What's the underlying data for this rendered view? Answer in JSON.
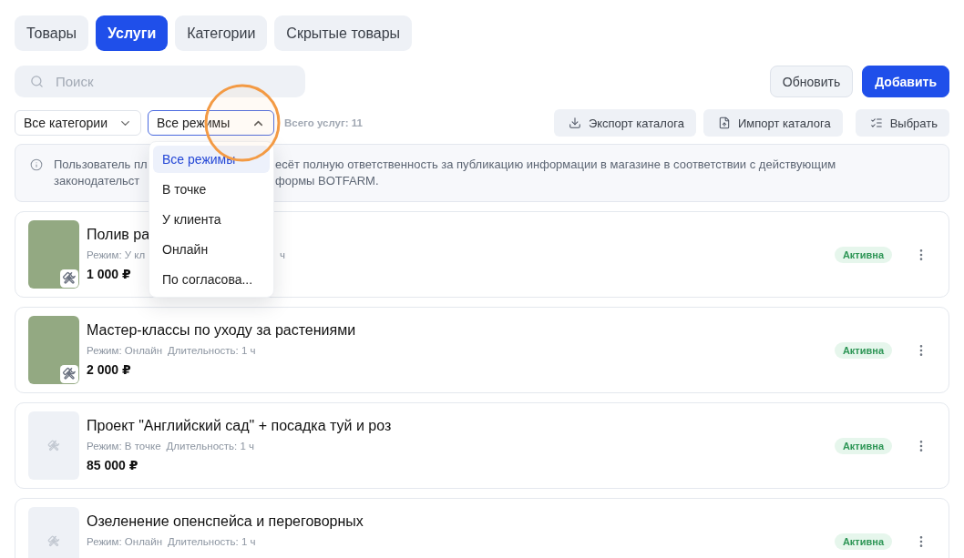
{
  "tabs": [
    {
      "label": "Товары",
      "selected": false
    },
    {
      "label": "Услуги",
      "selected": true
    },
    {
      "label": "Категории",
      "selected": false
    },
    {
      "label": "Скрытые товары",
      "selected": false
    }
  ],
  "search": {
    "placeholder": "Поиск"
  },
  "header_buttons": [
    {
      "label": "Обновить",
      "kind": "secondary"
    },
    {
      "label": "Добавить",
      "kind": "primary"
    }
  ],
  "filters": [
    {
      "value": "Все категории",
      "expanded": false
    },
    {
      "value": "Все режимы",
      "expanded": true,
      "options": [
        {
          "label": "Все режимы",
          "selected": true
        },
        {
          "label": "В точке",
          "selected": false
        },
        {
          "label": "У клиента",
          "selected": false
        },
        {
          "label": "Онлайн",
          "selected": false
        },
        {
          "label": "По согласова...",
          "selected": false
        }
      ]
    }
  ],
  "total": "Всего услуг: 11",
  "actions": [
    {
      "label": "Экспорт каталога"
    },
    {
      "label": "Импорт каталога"
    },
    {
      "label": "Выбрать"
    }
  ],
  "notice": {
    "lines": [
      [
        "Пользователь пл",
        "есёт полную ответственность за публикацию информации в магазине в соответствии с действующим"
      ],
      [
        "законодательст",
        "формы BOTFARM."
      ]
    ]
  },
  "services": [
    {
      "kind": "photo",
      "title": "Полив ра",
      "mode": "Режим: У кл",
      "duration": "ч",
      "price": "1 000 ₽",
      "status": "Активна",
      "partly_covered": true
    },
    {
      "kind": "photo",
      "title": "Мастер-классы по уходу за растениями",
      "mode": "Режим: Онлайн",
      "duration": "Длительность: 1 ч",
      "price": "2 000 ₽",
      "status": "Активна"
    },
    {
      "kind": "placeholder",
      "title": "Проект \"Английский сад\" + посадка туй и роз",
      "mode": "Режим: В точке",
      "duration": "Длительность: 1 ч",
      "price": "85 000 ₽",
      "status": "Активна"
    },
    {
      "kind": "placeholder",
      "title": "Озеленение опенспейса и переговорных",
      "mode": "Режим: Онлайн",
      "duration": "Длительность: 1 ч",
      "status": "Активна"
    }
  ]
}
